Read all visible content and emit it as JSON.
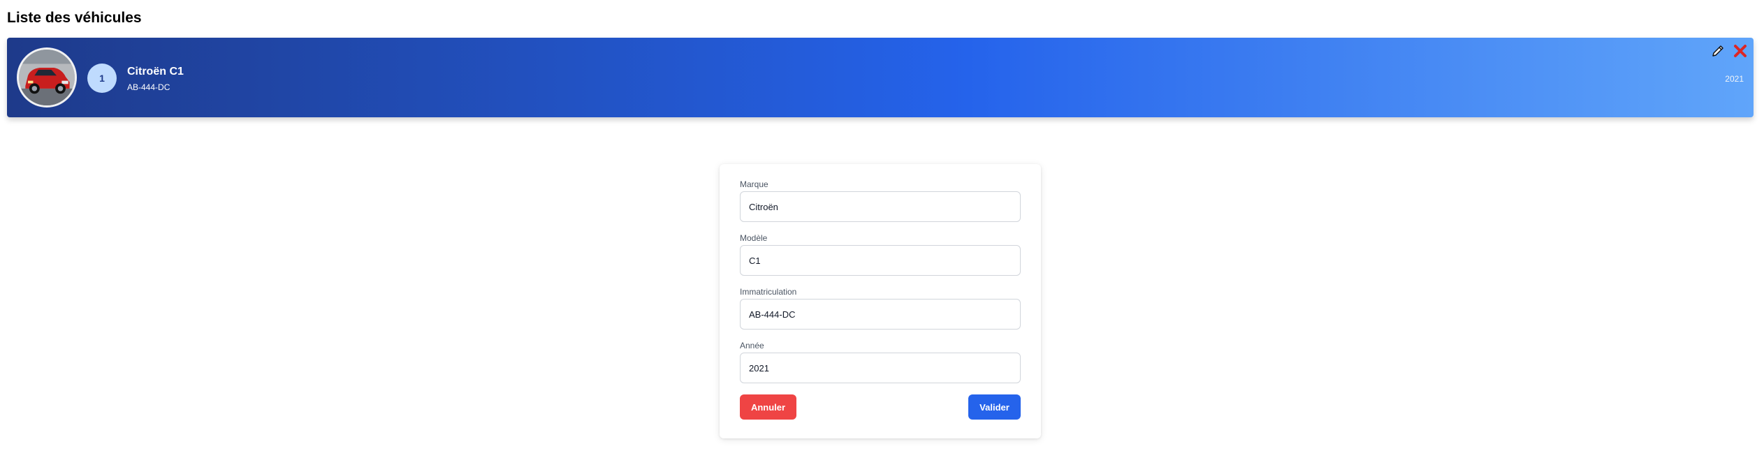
{
  "page": {
    "title": "Liste des véhicules"
  },
  "vehicle": {
    "index": "1",
    "name": "Citroën C1",
    "plate": "AB-444-DC",
    "year": "2021",
    "image_icon": "red-car-photo",
    "actions": [
      {
        "icon": "pencil-icon",
        "label": "Modifier"
      },
      {
        "icon": "close-icon",
        "label": "Supprimer",
        "color": "#dc2626"
      }
    ]
  },
  "form": {
    "fields": [
      {
        "label": "Marque",
        "value": "Citroën"
      },
      {
        "label": "Modèle",
        "value": "C1"
      },
      {
        "label": "Immatriculation",
        "value": "AB-444-DC"
      },
      {
        "label": "Année",
        "value": "2021"
      }
    ],
    "cancel_label": "Annuler",
    "submit_label": "Valider"
  },
  "colors": {
    "card_gradient_start": "#1e3a8a",
    "card_gradient_end": "#60a5fa",
    "cancel": "#ef4444",
    "submit": "#2563eb"
  }
}
